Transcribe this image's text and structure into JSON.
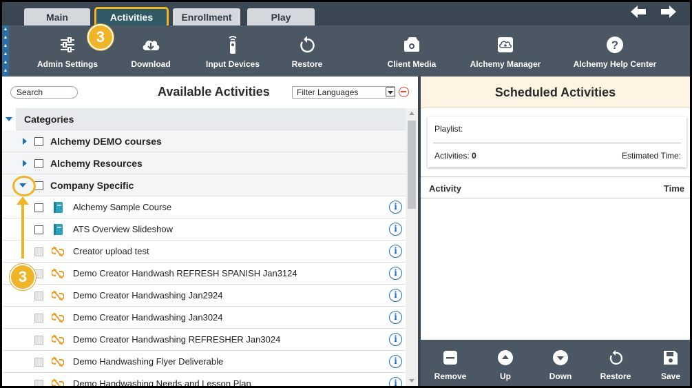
{
  "tabs": [
    {
      "label": "Main"
    },
    {
      "label": "Activities"
    },
    {
      "label": "Enrollment"
    },
    {
      "label": "Play"
    }
  ],
  "toolbar": {
    "items": [
      {
        "label": "Admin Settings",
        "icon": "sliders-icon"
      },
      {
        "label": "Download",
        "icon": "cloud-download-icon"
      },
      {
        "label": "Input Devices",
        "icon": "remote-icon"
      },
      {
        "label": "Restore",
        "icon": "restore-icon"
      },
      {
        "label": "Client Media",
        "icon": "media-icon"
      },
      {
        "label": "Alchemy Manager",
        "icon": "cloud-manager-icon"
      },
      {
        "label": "Alchemy Help Center",
        "icon": "help-icon"
      }
    ]
  },
  "annotations": {
    "step_top": "3",
    "step_left": "3",
    "highlight_color": "#f0b429"
  },
  "available": {
    "search_placeholder": "Search",
    "title": "Available Activities",
    "filter_placeholder": "Filter Languages",
    "categories_label": "Categories",
    "categories": [
      {
        "label": "Alchemy DEMO courses",
        "expanded": false
      },
      {
        "label": "Alchemy Resources",
        "expanded": false
      },
      {
        "label": "Company Specific",
        "expanded": true
      }
    ],
    "items": [
      {
        "label": "Alchemy Sample Course",
        "icon": "course-book-icon",
        "enabled": true
      },
      {
        "label": "ATS Overview Slideshow",
        "icon": "course-book-icon",
        "enabled": true
      },
      {
        "label": "Creator upload test",
        "icon": "broken-link-icon",
        "enabled": false
      },
      {
        "label": "Demo Creator Handwash REFRESH SPANISH Jan3124",
        "icon": "broken-link-icon",
        "enabled": false
      },
      {
        "label": "Demo Creator Handwashing Jan2924",
        "icon": "broken-link-icon",
        "enabled": false
      },
      {
        "label": "Demo Creator Handwashing Jan3024",
        "icon": "broken-link-icon",
        "enabled": false
      },
      {
        "label": "Demo Creator Handwashing REFRESHER Jan3024",
        "icon": "broken-link-icon",
        "enabled": false
      },
      {
        "label": "Demo Handwashing Flyer Deliverable",
        "icon": "broken-link-icon",
        "enabled": false
      },
      {
        "label": "Demo Handwashing Needs and Lesson Plan",
        "icon": "broken-link-icon",
        "enabled": false
      }
    ]
  },
  "scheduled": {
    "title": "Scheduled Activities",
    "playlist_label": "Playlist:",
    "activities_label": "Activities:",
    "activities_count": "0",
    "estimated_label": "Estimated Time:",
    "col_activity": "Activity",
    "col_time": "Time"
  },
  "bottom": {
    "items": [
      {
        "label": "Remove",
        "icon": "remove-icon"
      },
      {
        "label": "Up",
        "icon": "up-icon"
      },
      {
        "label": "Down",
        "icon": "down-icon"
      },
      {
        "label": "Restore",
        "icon": "restore-icon"
      },
      {
        "label": "Save",
        "icon": "save-icon"
      }
    ]
  },
  "colors": {
    "toolbar": "#4b5763",
    "tabbar": "#3a4651",
    "accent_blue": "#1e6fc2",
    "orange_icon": "#f29a1f",
    "teal_icon": "#2aa3b8"
  }
}
